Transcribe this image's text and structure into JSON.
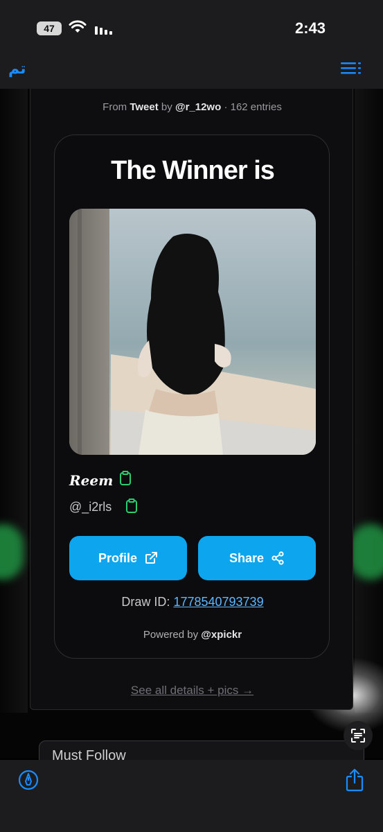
{
  "status_bar": {
    "battery": "47",
    "time": "2:43"
  },
  "nav": {
    "done_label": "تم",
    "menu_icon": "list-menu-icon"
  },
  "source": {
    "prefix": "From",
    "platform": "Tweet",
    "by": "by",
    "author": "@r_12wo",
    "entries": "· 162 entries"
  },
  "card": {
    "title": "The Winner is",
    "winner_name": "Reem",
    "winner_handle": "@_i2rls",
    "profile_label": "Profile",
    "share_label": "Share",
    "draw_label": "Draw ID:",
    "draw_id": "1778540793739",
    "powered_prefix": "Powered by",
    "powered_brand": "@xpickr"
  },
  "details_link": "See all details + pics →",
  "background": {
    "must_follow": "Must Follow"
  },
  "colors": {
    "accent": "#0ea5ef",
    "link": "#5eb8ff",
    "ios_blue": "#1a8cff",
    "copy_green": "#2ecc71"
  }
}
